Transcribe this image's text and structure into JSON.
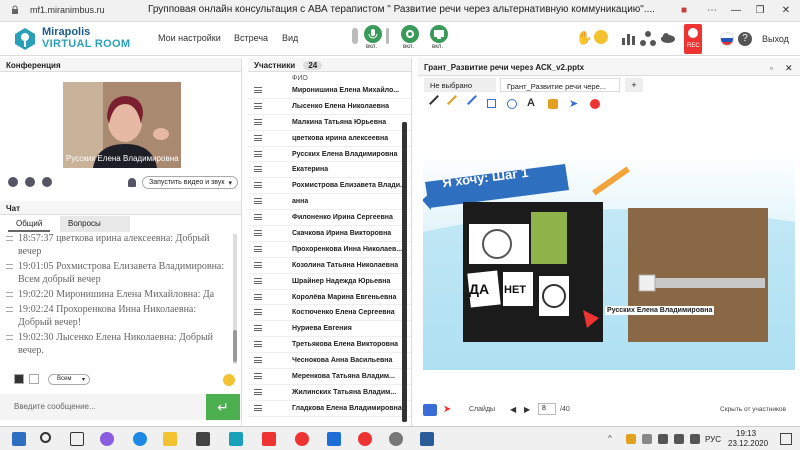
{
  "browser": {
    "url": "mf1.miranimbus.ru",
    "title": "Групповая онлайн консультация с АВА терапистом \" Развитие речи через альтернативную коммуникацию\"...."
  },
  "app": {
    "logo_line1": "Mirapolis",
    "logo_line2": "VIRTUAL ROOM",
    "menu": [
      "Мои настройки",
      "Встреча",
      "Вид"
    ],
    "mic_label": "вкл.",
    "cam_label": "вкл.",
    "screen_label": "вкл.",
    "rec_label": "REC",
    "exit_label": "Выход"
  },
  "conference": {
    "title": "Конференция",
    "video_name": "Русских Елена Владимировна",
    "share_button": "Запустить видео и звук"
  },
  "chat": {
    "title": "Чат",
    "tabs": [
      "Общий",
      "Вопросы"
    ],
    "messages": [
      {
        "time": "18:57:37",
        "text": "цветкова ирина алексеевна: Добрый вечер"
      },
      {
        "time": "19:01:05",
        "text": "Рохмистрова Елизавета Владимировна: Всем добрый вечер"
      },
      {
        "time": "19:02:20",
        "text": "Миронишина Елена Михайловна: Да"
      },
      {
        "time": "19:02:24",
        "text": "Прохоренкова Инна Николаевна: Добрый вечер!"
      },
      {
        "time": "19:02:30",
        "text": "Лысенко Елена Николаевна: Добрый вечер."
      }
    ],
    "audience": "Всем",
    "input_placeholder": "Введите сообщение...",
    "send_icon": "↵"
  },
  "participants": {
    "title": "Участники",
    "count": "24",
    "column": "ФИО",
    "list": [
      "Миронишина Елена Михайло...",
      "Лысенко Елена Николаевна",
      "Малкина Татьяна Юрьевна",
      "цветкова ирина алексеевна",
      "Русских Елена Владимировна",
      "Екатерина",
      "Рохмистрова Елизавета Влади...",
      "анна",
      "Филоненко Ирина Сергеевна",
      "Скачкова Ирина Викторовна",
      "Прохоренкова Инна Николаев...",
      "Козолина Татьяна Николаевна",
      "Шрайнер Надежда Юрьевна",
      "Королёва Марина Евгеньевна",
      "Костюченко Елена Сергеевна",
      "Нуриева Евгения",
      "Третьякова Елена Викторовна",
      "Чеснокова Анна Васильевна",
      "Меренкова Татьяна Владим...",
      "Жилинских Татьяна Владим...",
      "Гладкова Елена Владимировна"
    ]
  },
  "presentation": {
    "title": "Грант_Развитие речи через АСК_v2.pptx",
    "tabs": [
      "Не выбрано",
      "Грант_Развитие речи чере..."
    ],
    "add_tab": "+",
    "slide_heading": "Я хочу: Шаг 1",
    "card_yes": "ДА",
    "card_no": "НЕТ",
    "pointer_name": "Русских Елена Владимировна",
    "slides_label": "Слайды",
    "current_page": "8",
    "total_pages": "/40",
    "hide_label": "Скрыть от участников"
  },
  "taskbar": {
    "lang": "РУС",
    "time": "19:13",
    "date": "23.12.2020"
  }
}
